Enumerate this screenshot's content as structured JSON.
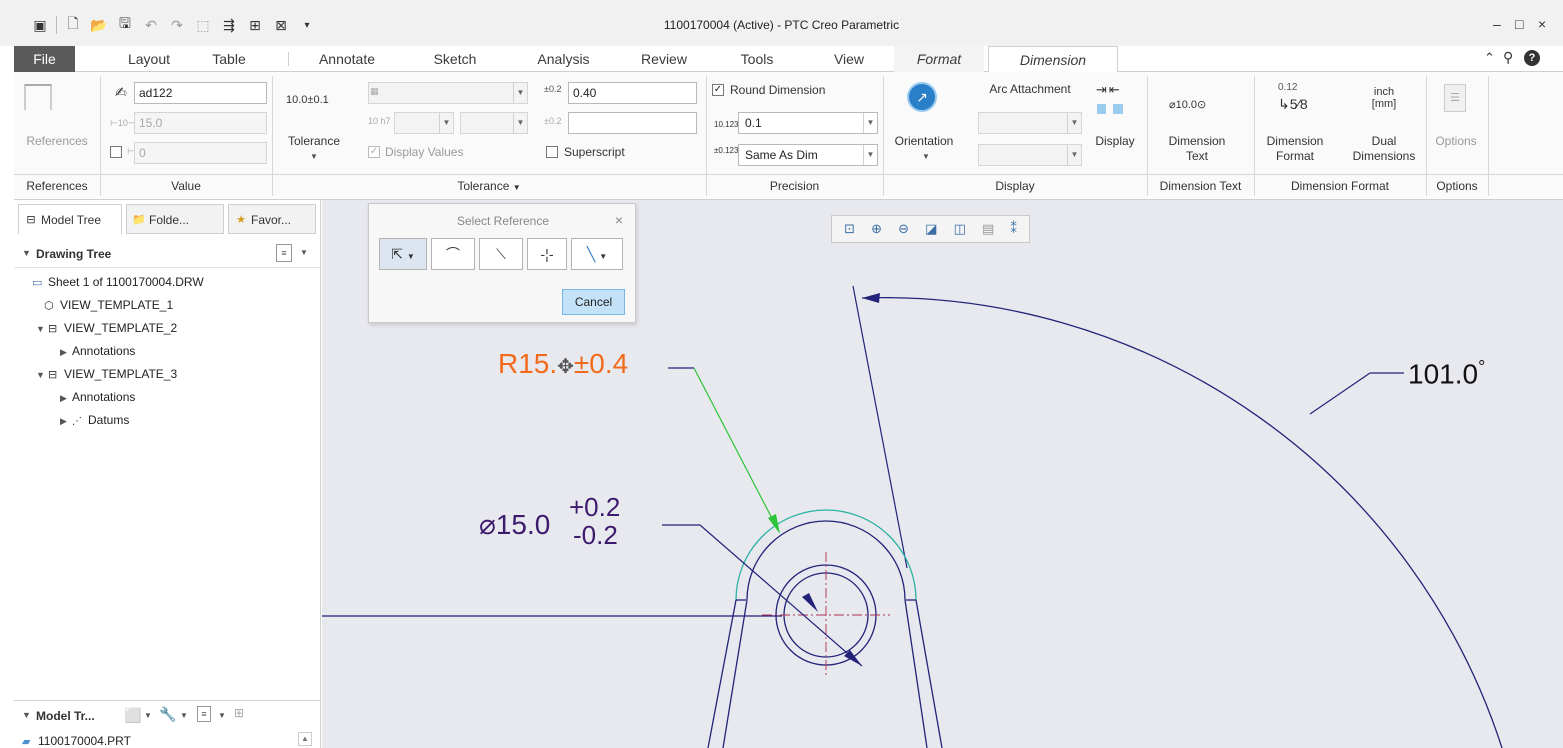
{
  "window": {
    "title": "1100170004 (Active) - PTC Creo Parametric",
    "controls": [
      "–",
      "□",
      "×"
    ]
  },
  "tabs": [
    {
      "label": "File"
    },
    {
      "label": "Layout"
    },
    {
      "label": "Table"
    },
    {
      "label": "Annotate"
    },
    {
      "label": "Sketch"
    },
    {
      "label": "Analysis"
    },
    {
      "label": "Review"
    },
    {
      "label": "Tools"
    },
    {
      "label": "View"
    },
    {
      "label": "Format"
    },
    {
      "label": "Dimension"
    }
  ],
  "ribbon": {
    "references": {
      "button": "References",
      "group": "References"
    },
    "value": {
      "name": "ad122",
      "nominal": "15.0",
      "override": "0",
      "group": "Value"
    },
    "tolerance": {
      "icon_text": "10.0±0.1",
      "button": "Tolerance",
      "upper": "0.40",
      "display_values": "Display Values",
      "superscript": "Superscript",
      "group": "Tolerance"
    },
    "precision": {
      "round_dimension": "Round Dimension",
      "decimal": "0.1",
      "tol_decimal": "Same As Dim",
      "decimal_icon": "10.123",
      "group": "Precision"
    },
    "display": {
      "orientation": "Orientation",
      "arc_attachment": "Arc Attachment",
      "display": "Display",
      "group": "Display"
    },
    "dimension_text": {
      "icon_text": "⌀10.0⊙",
      "button_line1": "Dimension",
      "button_line2": "Text",
      "group": "Dimension Text"
    },
    "dimension_format": {
      "frac_top": "0.12",
      "frac_icon": "↳5⁄8",
      "dual_top": "inch",
      "dual_bottom": "[mm]",
      "format_line1": "Dimension",
      "format_line2": "Format",
      "dual_line1": "Dual",
      "dual_line2": "Dimensions",
      "group": "Dimension Format"
    },
    "options": {
      "button": "Options",
      "group": "Options"
    }
  },
  "left_panel": {
    "tabs": [
      {
        "label": "Model Tree"
      },
      {
        "label": "Folde..."
      },
      {
        "label": "Favor..."
      }
    ],
    "drawing_tree_header": "Drawing Tree",
    "drawing_items": [
      {
        "label": "Sheet 1 of 1100170004.DRW"
      },
      {
        "label": "VIEW_TEMPLATE_1"
      },
      {
        "label": "VIEW_TEMPLATE_2"
      },
      {
        "label": "Annotations"
      },
      {
        "label": "VIEW_TEMPLATE_3"
      },
      {
        "label": "Annotations"
      },
      {
        "label": "Datums"
      }
    ],
    "model_tree_header": "Model Tr...",
    "model_item": "1100170004.PRT"
  },
  "select_reference": {
    "title": "Select Reference",
    "close": "×",
    "cancel": "Cancel"
  },
  "drawing": {
    "radius_dim": {
      "prefix": "R15.",
      "suffix": "0.4",
      "color": "#f26b1d"
    },
    "diameter_dim": {
      "main": "⌀15.0",
      "upper": "+0.2",
      "lower": "-0.2",
      "color": "#3c1a6e"
    },
    "angle_dim": {
      "value": "101.0",
      "unit": "°"
    }
  },
  "colors": {
    "canvas": "#e8e9ee",
    "geometry": "#23237a",
    "highlight": "#2bb3a3",
    "leader_green": "#2ec43a",
    "file_tab": "#5a5a5a"
  }
}
